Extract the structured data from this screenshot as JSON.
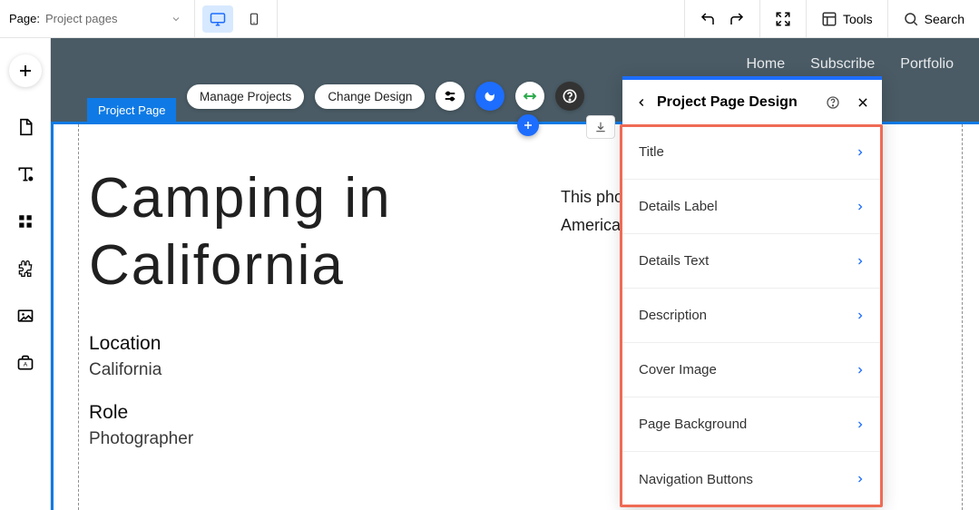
{
  "topbar": {
    "page_label": "Page:",
    "page_value": "Project pages",
    "tools_label": "Tools",
    "search_label": "Search"
  },
  "site_nav": {
    "items": [
      "Home",
      "Subscribe",
      "Portfolio"
    ]
  },
  "selection": {
    "tag_label": "Project Page"
  },
  "float_toolbar": {
    "manage_label": "Manage Projects",
    "change_design_label": "Change Design"
  },
  "page": {
    "title_line1": "Camping in",
    "title_line2": "California",
    "location_label": "Location",
    "location_value": "California",
    "role_label": "Role",
    "role_value": "Photographer",
    "description_line1": "This photo series captures life in an",
    "description_line2": "American national park, with all its beauty."
  },
  "panel": {
    "title": "Project Page Design",
    "items": [
      "Title",
      "Details Label",
      "Details Text",
      "Description",
      "Cover Image",
      "Page Background",
      "Navigation Buttons"
    ]
  }
}
